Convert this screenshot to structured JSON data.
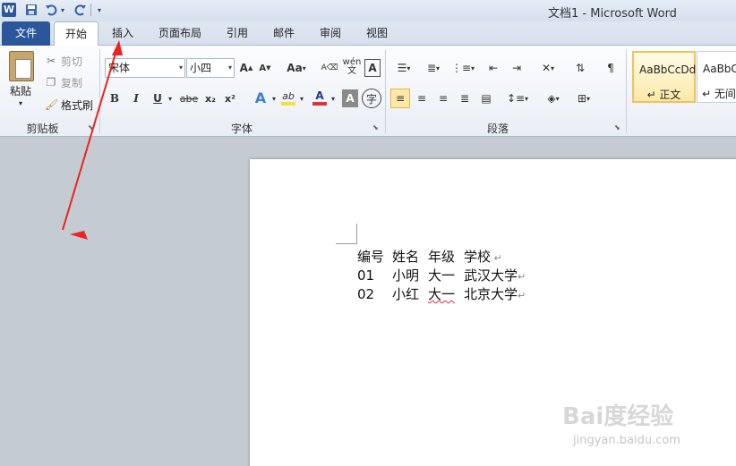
{
  "window": {
    "title": "文档1 - Microsoft Word",
    "app_icon": "W"
  },
  "quick_access": {
    "save": "save-icon",
    "undo": "undo-icon",
    "redo": "redo-icon"
  },
  "tabs": [
    "文件",
    "开始",
    "插入",
    "页面布局",
    "引用",
    "邮件",
    "审阅",
    "视图"
  ],
  "active_tab": "开始",
  "clipboard": {
    "label": "剪贴板",
    "paste": "粘贴",
    "cut": "剪切",
    "copy": "复制",
    "format_painter": "格式刷"
  },
  "font": {
    "label": "字体",
    "name": "宋体",
    "size": "小四",
    "change_case": "Aa",
    "bold": "B",
    "italic": "I",
    "underline": "U",
    "strike": "abe",
    "subscript": "x₂",
    "superscript": "x²",
    "text_effects": "A",
    "highlight": "ab",
    "font_color": "A",
    "char_shading": "A",
    "enclose": "字",
    "grow": "A",
    "shrink": "A",
    "phonetic": "wén",
    "char_border": "A"
  },
  "paragraph": {
    "label": "段落"
  },
  "styles": {
    "normal_sample": "AaBbCcDd",
    "normal_name": "↵ 正文",
    "nospace_sample": "AaBbCc",
    "nospace_name": "↵ 无间"
  },
  "document": {
    "header": [
      "编号",
      "姓名",
      "年级",
      "学校"
    ],
    "rows": [
      [
        "01",
        "小明",
        "大一",
        "武汉大学"
      ],
      [
        "02",
        "小红",
        "大一",
        "北京大学"
      ]
    ]
  },
  "watermark": {
    "brand": "Bai度经验",
    "url": "jingyan.baidu.com"
  },
  "colors": {
    "file_tab": "#2b579a",
    "highlight": "#f5e13b",
    "font_color_bar": "#e0303a",
    "annotation_arrow": "#e8251f"
  }
}
